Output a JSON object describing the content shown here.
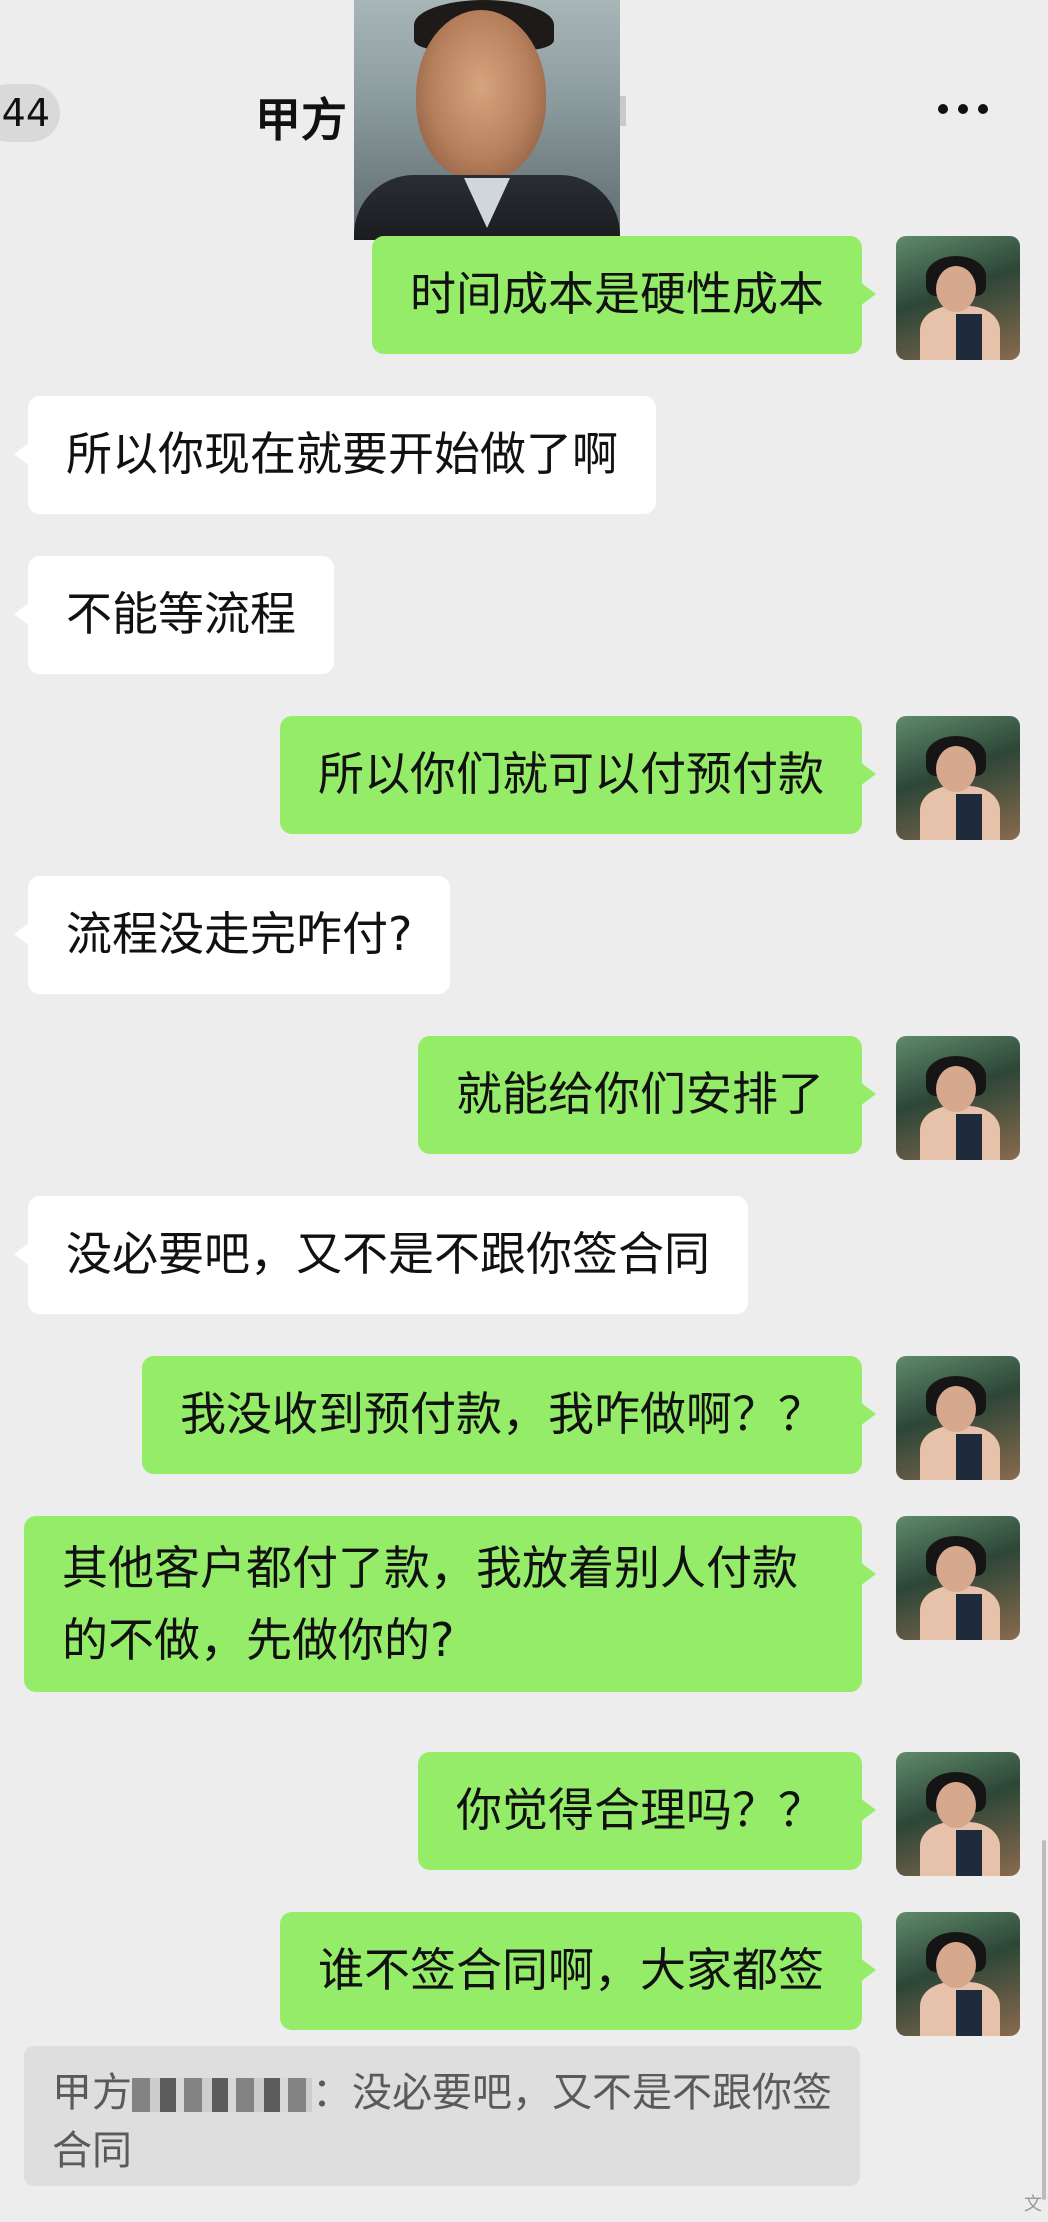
{
  "header": {
    "back_badge": "44",
    "title": "甲方",
    "more_icon": "more-dots-icon"
  },
  "messages": [
    {
      "side": "me",
      "text": "时间成本是硬性成本"
    },
    {
      "side": "them",
      "text": "所以你现在就要开始做了啊"
    },
    {
      "side": "them",
      "text": "不能等流程"
    },
    {
      "side": "me",
      "text": "所以你们就可以付预付款"
    },
    {
      "side": "them",
      "text": "流程没走完咋付?"
    },
    {
      "side": "me",
      "text": "就能给你们安排了"
    },
    {
      "side": "them",
      "text": "没必要吧，又不是不跟你签合同"
    },
    {
      "side": "me",
      "text": "我没收到预付款，我咋做啊？？"
    },
    {
      "side": "me",
      "text": "其他客户都付了款，我放着别人付款的不做，先做你的?"
    },
    {
      "side": "me",
      "text": "你觉得合理吗？？"
    },
    {
      "side": "me",
      "text": "谁不签合同啊，大家都签"
    }
  ],
  "quote": {
    "sender": "甲方",
    "text": "：没必要吧，又不是不跟你签合同"
  },
  "colors": {
    "me_bubble": "#95ec69",
    "them_bubble": "#ffffff",
    "background": "#ededed"
  },
  "watermark": "文"
}
